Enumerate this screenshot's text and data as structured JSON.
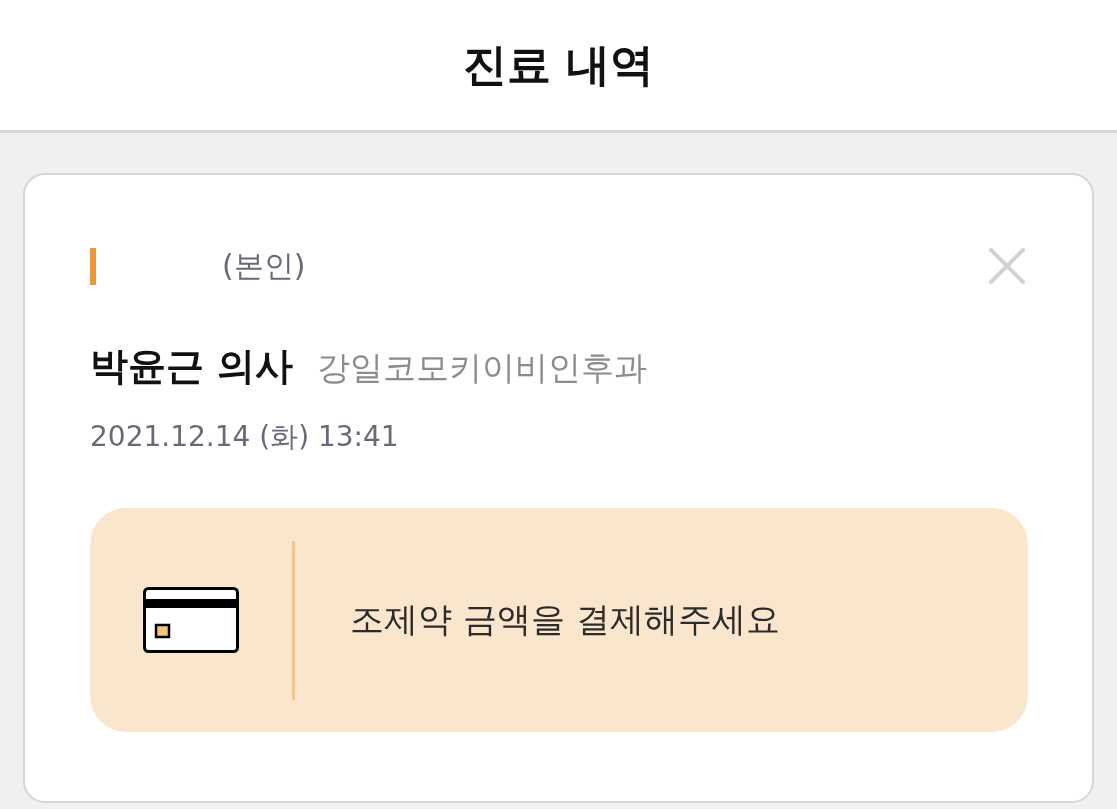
{
  "header": {
    "title": "진료 내역"
  },
  "record": {
    "relation": "(본인)",
    "doctor": "박윤근 의사",
    "clinic": "강일코모키이비인후과",
    "datetime": "2021.12.14 (화) 13:41",
    "payment": {
      "text": "조제약 금액을 결제해주세요"
    }
  }
}
